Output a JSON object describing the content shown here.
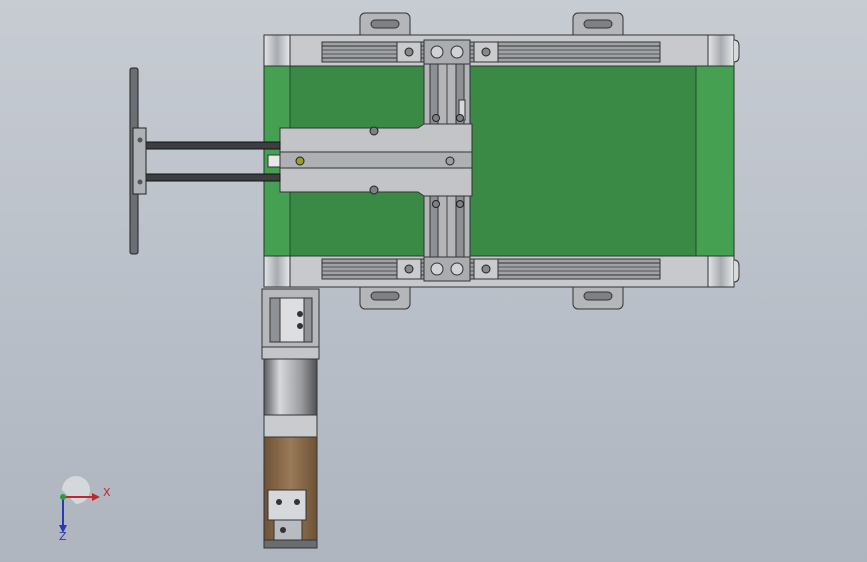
{
  "colors": {
    "background_top": "#c7ccd3",
    "background_bottom": "#aeb5bf",
    "belt_green": "#3a8a45",
    "frame_gray": "#b8babd",
    "motor_brown": "#8b6a4a",
    "axis_x": "#c0272d",
    "axis_y": "#2e9a3c",
    "axis_z": "#2a3bb0"
  },
  "triad": {
    "x_label": "X",
    "z_label": "Z"
  }
}
